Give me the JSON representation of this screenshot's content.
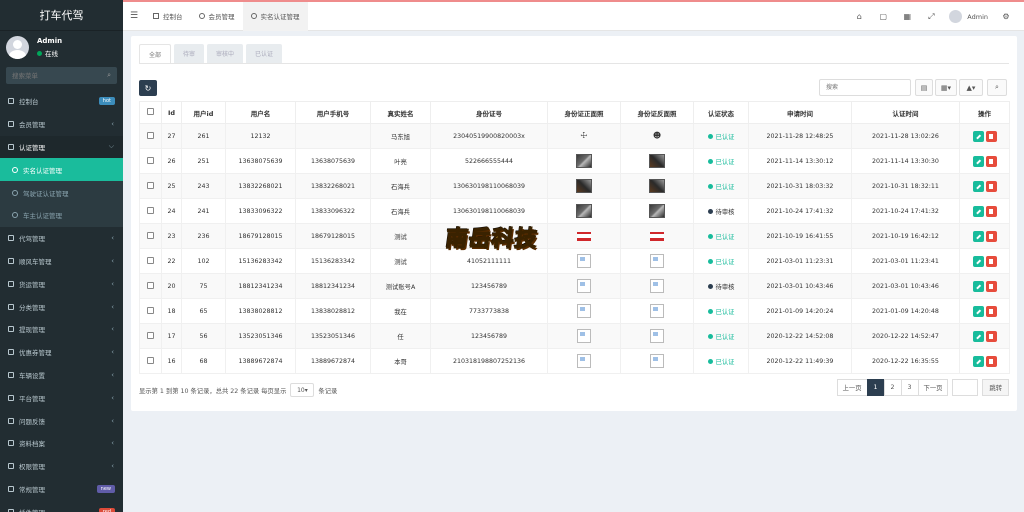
{
  "sidebar": {
    "brand": "打车代驾",
    "user": {
      "name": "Admin",
      "status": "在线"
    },
    "search_placeholder": "搜索菜单",
    "items": [
      {
        "label": "控制台",
        "badge": "hot"
      },
      {
        "label": "会员管理"
      },
      {
        "label": "认证管理",
        "open": true,
        "children": [
          {
            "label": "实名认证管理",
            "active": true
          },
          {
            "label": "驾驶证认证管理"
          },
          {
            "label": "车主认证管理"
          }
        ]
      },
      {
        "label": "代驾管理"
      },
      {
        "label": "顺风车管理"
      },
      {
        "label": "货运管理"
      },
      {
        "label": "分类管理"
      },
      {
        "label": "提现管理"
      },
      {
        "label": "优惠券管理"
      },
      {
        "label": "车辆设置"
      },
      {
        "label": "平台管理"
      },
      {
        "label": "问题反馈"
      },
      {
        "label": "资料档案"
      },
      {
        "label": "权限管理"
      },
      {
        "label": "常规管理",
        "badge": "new"
      },
      {
        "label": "插件管理",
        "badge": "red"
      }
    ]
  },
  "topbar": {
    "tabs": [
      {
        "label": "控制台"
      },
      {
        "label": "会员管理"
      },
      {
        "label": "实名认证管理",
        "active": true
      }
    ],
    "user": "Admin"
  },
  "filter_tabs": [
    "全部",
    "待审",
    "审核中",
    "已认证"
  ],
  "toolbar": {
    "search_placeholder": "搜索"
  },
  "table": {
    "headers": [
      "Id",
      "用户id",
      "用户名",
      "用户手机号",
      "真实姓名",
      "身份证号",
      "身份证正面照",
      "身份证反面照",
      "认证状态",
      "申请时间",
      "认证时间",
      "操作"
    ],
    "rows": [
      {
        "id": "27",
        "uid": "261",
        "username": "12132",
        "phone": "",
        "name": "马东旭",
        "idno": "23040519900820003x",
        "front": "ico",
        "back": "ico2",
        "status": "已认证",
        "applied": "2021-11-28 12:48:25",
        "verified": "2021-11-28 13:02:26"
      },
      {
        "id": "26",
        "uid": "251",
        "username": "13638075639",
        "phone": "13638075639",
        "name": "叶亮",
        "idno": "522666555444",
        "front": "photo",
        "back": "photo2",
        "status": "已认证",
        "applied": "2021-11-14 13:30:12",
        "verified": "2021-11-14 13:30:30"
      },
      {
        "id": "25",
        "uid": "243",
        "username": "13832268021",
        "phone": "13832268021",
        "name": "石海兵",
        "idno": "130630198110068039",
        "front": "photo2",
        "back": "photo2",
        "status": "已认证",
        "applied": "2021-10-31 18:03:32",
        "verified": "2021-10-31 18:32:11"
      },
      {
        "id": "24",
        "uid": "241",
        "username": "13833096322",
        "phone": "13833096322",
        "name": "石海兵",
        "idno": "130630198110068039",
        "front": "photo",
        "back": "photo",
        "status": "待审核",
        "applied": "2021-10-24 17:41:32",
        "verified": "2021-10-24 17:41:32"
      },
      {
        "id": "23",
        "uid": "236",
        "username": "18679128015",
        "phone": "18679128015",
        "name": "测试",
        "idno": "",
        "front": "red",
        "back": "red",
        "status": "已认证",
        "applied": "2021-10-19 16:41:55",
        "verified": "2021-10-19 16:42:12"
      },
      {
        "id": "22",
        "uid": "102",
        "username": "15136283342",
        "phone": "15136283342",
        "name": "测试",
        "idno": "41052111111",
        "front": "broken",
        "back": "broken",
        "status": "已认证",
        "applied": "2021-03-01 11:23:31",
        "verified": "2021-03-01 11:23:41"
      },
      {
        "id": "20",
        "uid": "75",
        "username": "18812341234",
        "phone": "18812341234",
        "name": "测试账号A",
        "idno": "123456789",
        "front": "broken",
        "back": "broken",
        "status": "待审核",
        "applied": "2021-03-01 10:43:46",
        "verified": "2021-03-01 10:43:46"
      },
      {
        "id": "18",
        "uid": "65",
        "username": "13838028812",
        "phone": "13838028812",
        "name": "我在",
        "idno": "7733773838",
        "front": "broken",
        "back": "broken",
        "status": "已认证",
        "applied": "2021-01-09 14:20:24",
        "verified": "2021-01-09 14:20:48"
      },
      {
        "id": "17",
        "uid": "56",
        "username": "13523051346",
        "phone": "13523051346",
        "name": "任",
        "idno": "123456789",
        "front": "broken",
        "back": "broken",
        "status": "已认证",
        "applied": "2020-12-22 14:52:08",
        "verified": "2020-12-22 14:52:47"
      },
      {
        "id": "16",
        "uid": "68",
        "username": "13889672874",
        "phone": "13889672874",
        "name": "本哥",
        "idno": "210318198807252136",
        "front": "broken",
        "back": "broken",
        "status": "已认证",
        "applied": "2020-12-22 11:49:39",
        "verified": "2020-12-22 16:35:55"
      }
    ]
  },
  "pagination": {
    "info_prefix": "显示第 1 到第 10 条记录，总共 22 条记录 每页显示",
    "page_size": "10",
    "info_suffix": "条记录",
    "prev": "上一页",
    "pages": [
      "1",
      "2",
      "3"
    ],
    "next": "下一页",
    "go": "跳转"
  },
  "watermark": "南岳科技"
}
